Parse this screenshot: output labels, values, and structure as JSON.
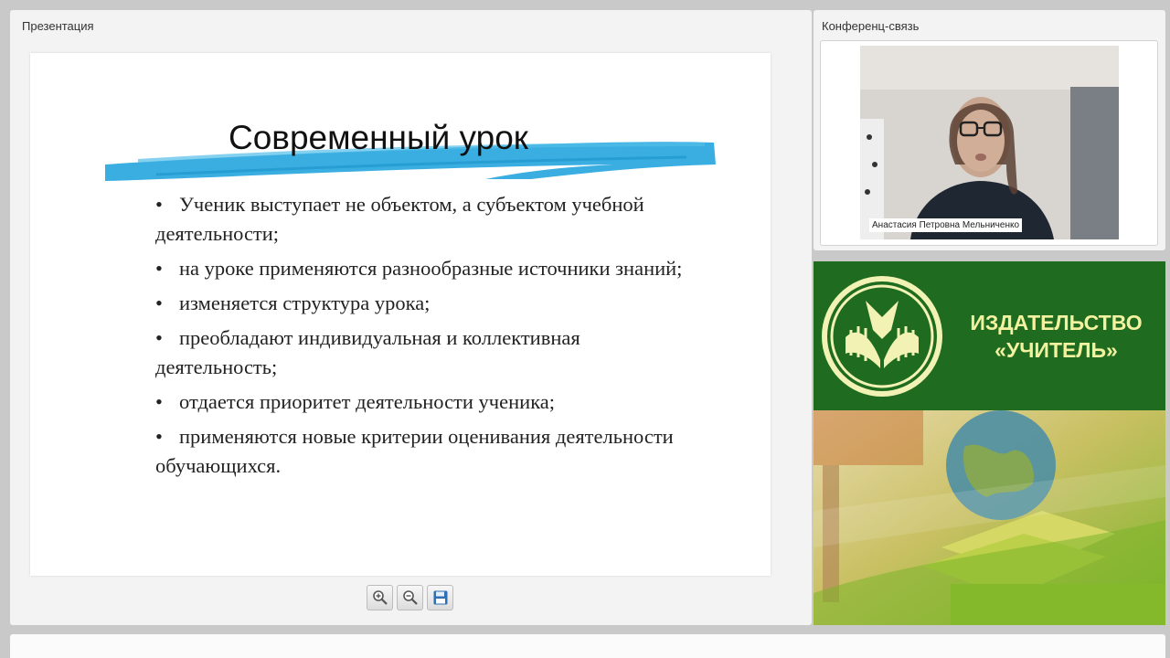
{
  "presentation": {
    "panel_title": "Презентация",
    "slide": {
      "title": "Современный урок",
      "bullet_symbol": "•",
      "bullets": [
        "Ученик выступает не объектом, а субъектом учебной деятельности;",
        "на уроке применяются разнообразные источники знаний;",
        "изменяется структура урока;",
        "преобладают индивидуальная и коллективная деятельность;",
        "отдается приоритет деятельности ученика;",
        "применяются новые критерии оценивания деятельности обучающихся."
      ],
      "brush_color": "#2aa7de"
    },
    "toolbar": {
      "zoom_in_icon": "zoom-in-icon",
      "zoom_out_icon": "zoom-out-icon",
      "save_icon": "floppy-disk-icon"
    }
  },
  "conference": {
    "panel_title": "Конференц-связь",
    "participant_name": "Анастасия Петровна Мельниченко"
  },
  "banner": {
    "line1": "ИЗДАТЕЛЬСТВО",
    "line2": "«УЧИТЕЛЬ»",
    "bg_color": "#1f6b1f",
    "text_color": "#f3f2a0"
  }
}
